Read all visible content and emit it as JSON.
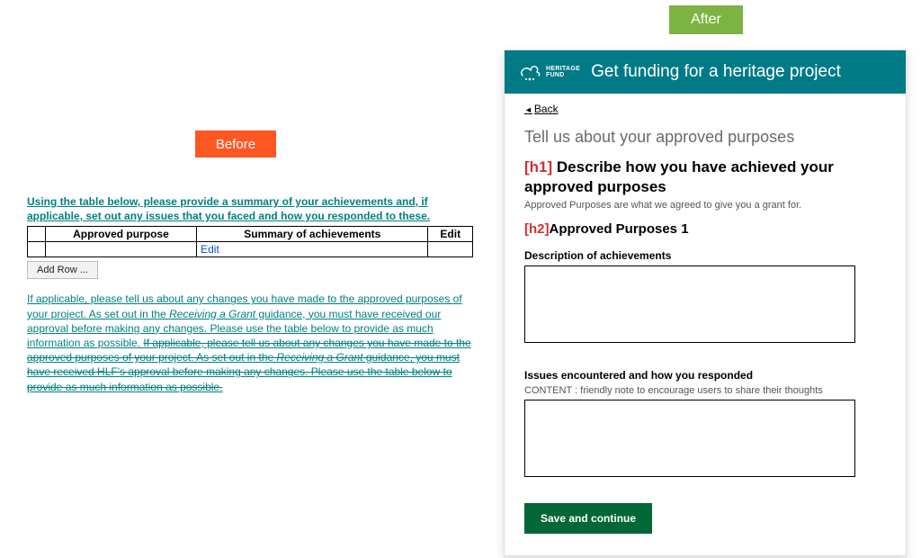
{
  "before": {
    "badge": "Before",
    "intro": "Using the table below, please provide a summary of your achievements and, if applicable, set out any issues that you faced and how you responded to these.",
    "table": {
      "col_approved": "Approved purpose",
      "col_summary": "Summary of achievements",
      "col_edit": "Edit",
      "edit_link": "Edit"
    },
    "add_row": "Add Row ...",
    "para_main_a": "If applicable, please tell us about any changes you have made to the approved purposes of your project. As set out in the ",
    "para_main_italic1": "Receiving a Grant",
    "para_main_b": " guidance, you must have received our approval before making any changes. Please use the table below to provide as much information as possible. ",
    "para_strike_a": "If applicable, please tell us about any changes you have made to the approved purposes of your project. As set out in the ",
    "para_strike_italic": "Receiving a Grant",
    "para_strike_b": " guidance, you must have received HLF's approval before making any changes. Please use the table below to provide as much information as possible."
  },
  "after": {
    "badge": "After",
    "logo_line1": "HERITAGE",
    "logo_line2": "FUND",
    "header_title": "Get funding for a heritage project",
    "back": "Back",
    "section_intro": "Tell us about your approved purposes",
    "h1_marker": "[h1] ",
    "h1_text": "Describe how you have achieved your approved purposes",
    "help": "Approved Purposes are what we agreed to give you a grant for.",
    "h2_marker": "[h2]",
    "h2_text": "Approved Purposes 1",
    "field1_label": "Description of achievements",
    "field2_label": "Issues encountered and how you responded",
    "field2_note": "CONTENT : friendly note to encourage users to share their thoughts",
    "save_btn": "Save and continue"
  }
}
